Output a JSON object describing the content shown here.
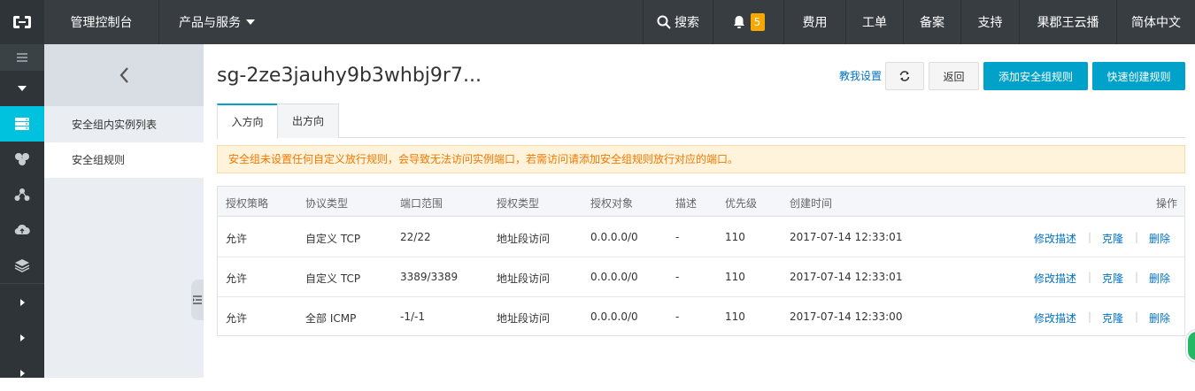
{
  "topbar": {
    "console": "管理控制台",
    "products": "产品与服务",
    "search": "搜索",
    "notification_count": "5",
    "billing": "费用",
    "tickets": "工单",
    "icp": "备案",
    "support": "支持",
    "user": "果郡王云播",
    "language": "简体中文"
  },
  "subnav": {
    "items": [
      {
        "label": "安全组内实例列表"
      },
      {
        "label": "安全组规则"
      }
    ]
  },
  "header": {
    "title": "sg-2ze3jauhy9b3whbj9r7...",
    "guide_link": "教我设置",
    "back_button": "返回",
    "add_rule_button": "添加安全组规则",
    "quick_create_button": "快速创建规则"
  },
  "tabs": [
    {
      "label": "入方向",
      "active": true
    },
    {
      "label": "出方向",
      "active": false
    }
  ],
  "notice": "安全组未设置任何自定义放行规则，会导致无法访问实例端口，若需访问请添加安全组规则放行对应的端口。",
  "table": {
    "columns": [
      "授权策略",
      "协议类型",
      "端口范围",
      "授权类型",
      "授权对象",
      "描述",
      "优先级",
      "创建时间",
      "操作"
    ],
    "rows": [
      {
        "policy": "允许",
        "protocol": "自定义 TCP",
        "port": "22/22",
        "auth_type": "地址段访问",
        "object": "0.0.0.0/0",
        "desc": "-",
        "priority": "110",
        "created": "2017-07-14 12:33:01"
      },
      {
        "policy": "允许",
        "protocol": "自定义 TCP",
        "port": "3389/3389",
        "auth_type": "地址段访问",
        "object": "0.0.0.0/0",
        "desc": "-",
        "priority": "110",
        "created": "2017-07-14 12:33:01"
      },
      {
        "policy": "允许",
        "protocol": "全部 ICMP",
        "port": "-1/-1",
        "auth_type": "地址段访问",
        "object": "0.0.0.0/0",
        "desc": "-",
        "priority": "110",
        "created": "2017-07-14 12:33:00"
      }
    ],
    "actions": {
      "edit": "修改描述",
      "clone": "克隆",
      "delete": "删除",
      "separator": "|"
    }
  },
  "colors": {
    "topbar": "#373d41",
    "accent": "#00a2ca",
    "link": "#0072c6",
    "warning": "#f07800"
  }
}
